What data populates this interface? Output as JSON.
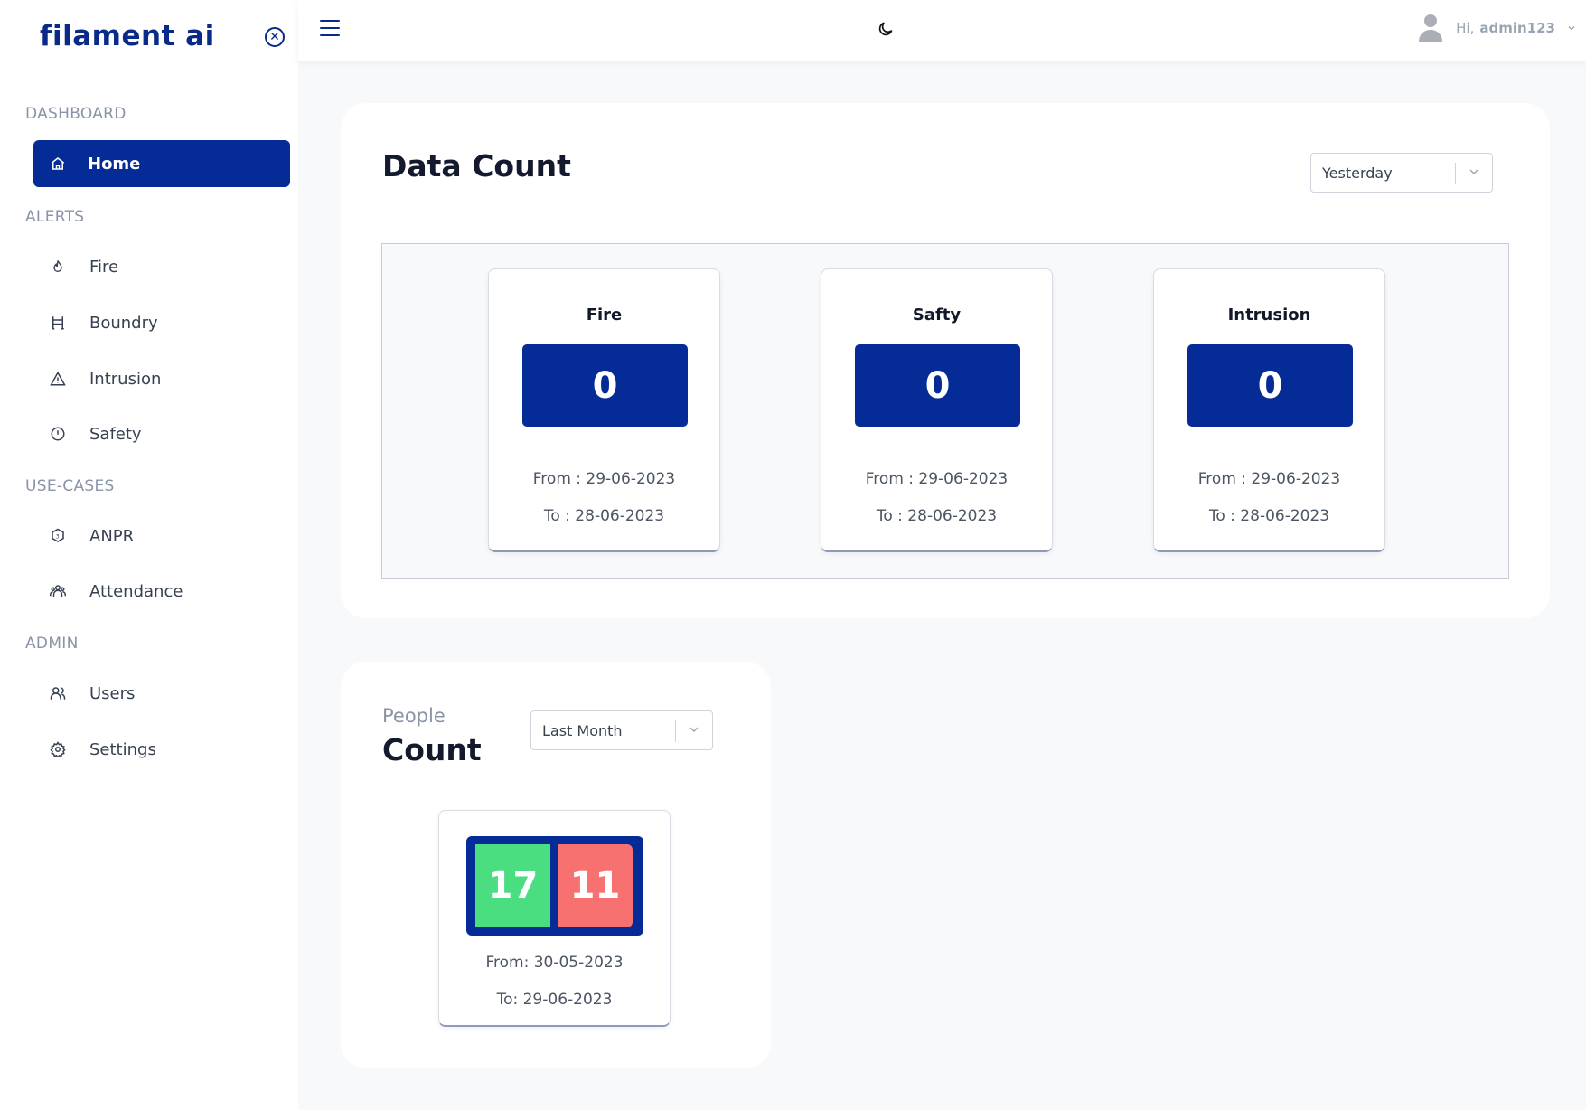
{
  "brand": {
    "logo_text": "filament ai"
  },
  "sidebar": {
    "sections": {
      "dashboard": "DASHBOARD",
      "alerts": "ALERTS",
      "use_cases": "USE-CASES",
      "admin": "ADMIN"
    },
    "items": {
      "home": "Home",
      "fire": "Fire",
      "boundry": "Boundry",
      "intrusion": "Intrusion",
      "safety": "Safety",
      "anpr": "ANPR",
      "attendance": "Attendance",
      "users": "Users",
      "settings": "Settings"
    },
    "active_item": "home"
  },
  "topbar": {
    "greeting": "Hi,",
    "username": "admin123"
  },
  "data_count": {
    "title": "Data Count",
    "range_select": "Yesterday",
    "cards": [
      {
        "label": "Fire",
        "count": "0",
        "from": "From : 29-06-2023",
        "to": "To : 28-06-2023"
      },
      {
        "label": "Safty",
        "count": "0",
        "from": "From : 29-06-2023",
        "to": "To : 28-06-2023"
      },
      {
        "label": "Intrusion",
        "count": "0",
        "from": "From : 29-06-2023",
        "to": "To : 28-06-2023"
      }
    ]
  },
  "people_count": {
    "subtitle": "People",
    "title": "Count",
    "range_select": "Last Month",
    "in_count": "17",
    "out_count": "11",
    "from": "From: 30-05-2023",
    "to": "To: 29-06-2023"
  },
  "colors": {
    "brand_blue": "#052b96",
    "in_green": "#4ade80",
    "out_red": "#f87171"
  }
}
